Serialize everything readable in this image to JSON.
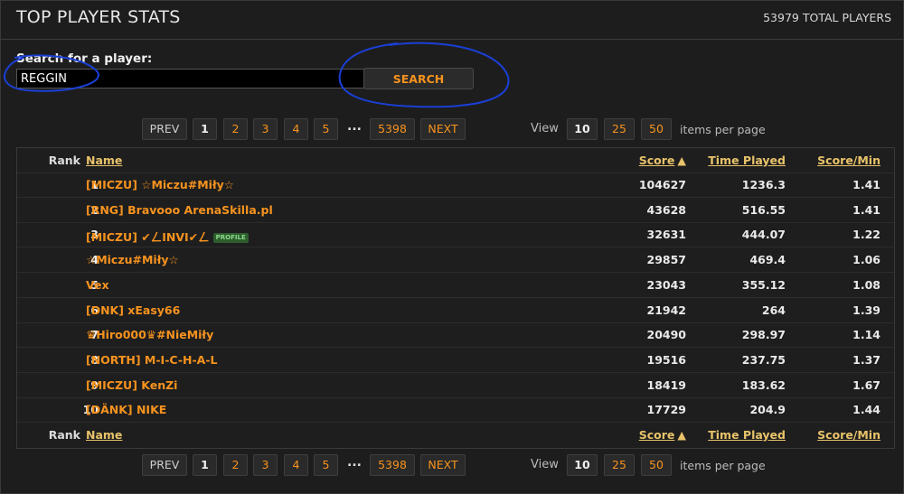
{
  "header": {
    "title": "TOP PLAYER STATS",
    "total_players": "53979 TOTAL PLAYERS"
  },
  "search": {
    "label": "Search for a player:",
    "value": "REGGIN",
    "button_label": "SEARCH"
  },
  "pagination": {
    "prev_label": "PREV",
    "next_label": "NEXT",
    "pages": [
      "1",
      "2",
      "3",
      "4",
      "5"
    ],
    "current_page": "1",
    "ellipsis": "...",
    "last_page": "5398",
    "view_label": "View",
    "items_per_page_options": [
      "10",
      "25",
      "50"
    ],
    "items_per_page_suffix": "items per page"
  },
  "table": {
    "columns": {
      "rank": "Rank",
      "name": "Name",
      "score": "Score",
      "time": "Time Played",
      "spm": "Score/Min"
    },
    "sort_indicator": "▲",
    "rows": [
      {
        "rank": "1",
        "name": "[MICZU] ☆Miczu#Miły☆",
        "badge": "",
        "score": "104627",
        "time": "1236.3",
        "spm": "1.41"
      },
      {
        "rank": "2",
        "name": "[RNG] Bravooo ArenaSkilla.pl",
        "badge": "",
        "score": "43628",
        "time": "516.55",
        "spm": "1.41"
      },
      {
        "rank": "3",
        "name": "[MICZU] ✔ㄥINVI✔ㄥ",
        "badge": "PROFILE",
        "score": "32631",
        "time": "444.07",
        "spm": "1.22"
      },
      {
        "rank": "4",
        "name": "☆Miczu#Miły☆",
        "badge": "",
        "score": "29857",
        "time": "469.4",
        "spm": "1.06"
      },
      {
        "rank": "5",
        "name": "Vex",
        "badge": "",
        "score": "23043",
        "time": "355.12",
        "spm": "1.08"
      },
      {
        "rank": "6",
        "name": "[DNK] xEasy66",
        "badge": "",
        "score": "21942",
        "time": "264",
        "spm": "1.39"
      },
      {
        "rank": "7",
        "name": "♛Hiro000♛#NieMiły",
        "badge": "",
        "score": "20490",
        "time": "298.97",
        "spm": "1.14"
      },
      {
        "rank": "8",
        "name": "[NORTH] M-I-C-H-A-L",
        "badge": "",
        "score": "19516",
        "time": "237.75",
        "spm": "1.37"
      },
      {
        "rank": "9",
        "name": "[MICZU] KenZi",
        "badge": "",
        "score": "18419",
        "time": "183.62",
        "spm": "1.67"
      },
      {
        "rank": "10",
        "name": "[DÄNK] NIKE",
        "badge": "",
        "score": "17729",
        "time": "204.9",
        "spm": "1.44"
      }
    ]
  },
  "colors": {
    "accent": "#f7931e",
    "header_link": "#e8c36a",
    "annotation": "#1a3fd6",
    "badge_bg": "#2e5d2e"
  }
}
